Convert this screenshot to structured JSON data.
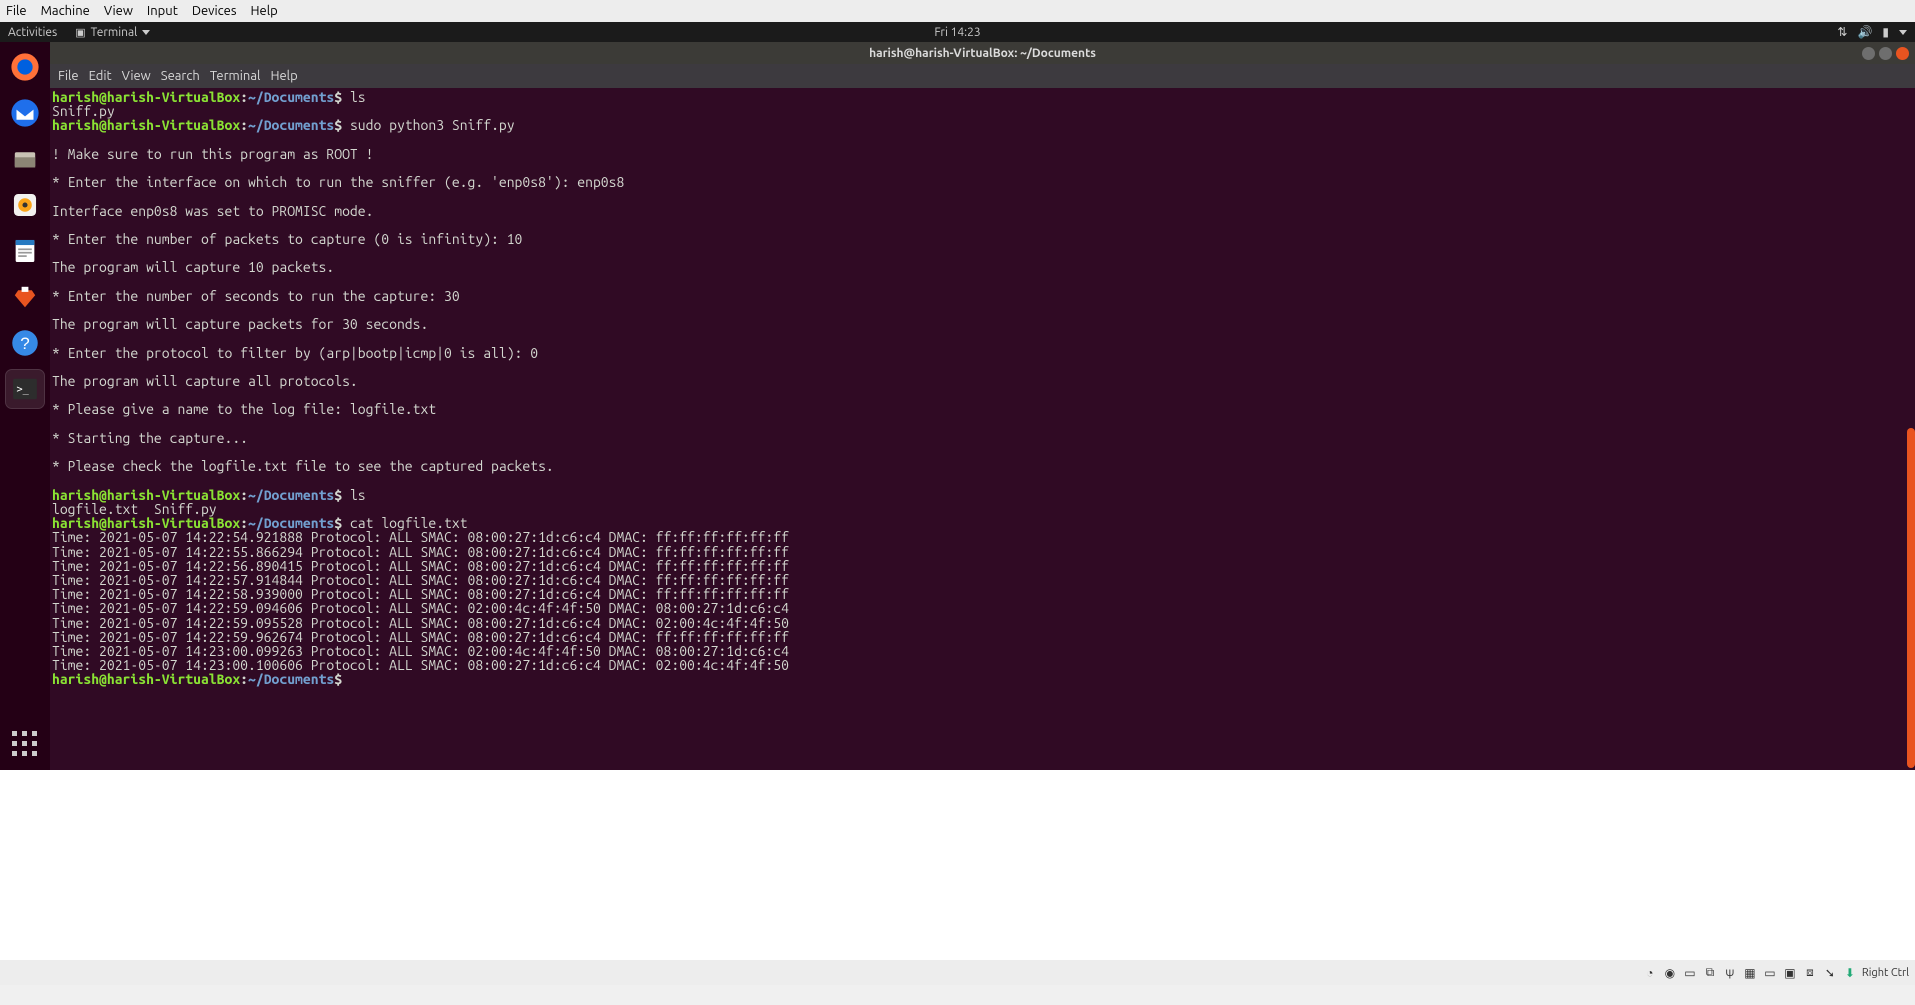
{
  "vbox_menu": [
    "File",
    "Machine",
    "View",
    "Input",
    "Devices",
    "Help"
  ],
  "gnome": {
    "activities": "Activities",
    "app": "Terminal",
    "time": "Fri 14:23"
  },
  "window": {
    "title": "harish@harish-VirtualBox: ~/Documents",
    "menus": [
      "File",
      "Edit",
      "View",
      "Search",
      "Terminal",
      "Help"
    ]
  },
  "prompt": {
    "user": "harish@harish-VirtualBox",
    "path": "~/Documents",
    "sep": ":",
    "sym": "$"
  },
  "cmd": {
    "ls1": "ls",
    "lsout1": "Sniff.py",
    "run": "sudo python3 Sniff.py",
    "ls2": "ls",
    "lsout2": "logfile.txt  Sniff.py",
    "cat": "cat logfile.txt"
  },
  "prog": {
    "l1": "! Make sure to run this program as ROOT !",
    "l2": "* Enter the interface on which to run the sniffer (e.g. 'enp0s8'): enp0s8",
    "l3": "Interface enp0s8 was set to PROMISC mode.",
    "l4": "* Enter the number of packets to capture (0 is infinity): 10",
    "l5": "The program will capture 10 packets.",
    "l6": "* Enter the number of seconds to run the capture: 30",
    "l7": "The program will capture packets for 30 seconds.",
    "l8": "* Enter the protocol to filter by (arp|bootp|icmp|0 is all): 0",
    "l9": "The program will capture all protocols.",
    "l10": "* Please give a name to the log file: logfile.txt",
    "l11": "* Starting the capture...",
    "l12": "* Please check the logfile.txt file to see the captured packets."
  },
  "log": [
    "Time: 2021-05-07 14:22:54.921888 Protocol: ALL SMAC: 08:00:27:1d:c6:c4 DMAC: ff:ff:ff:ff:ff:ff",
    "Time: 2021-05-07 14:22:55.866294 Protocol: ALL SMAC: 08:00:27:1d:c6:c4 DMAC: ff:ff:ff:ff:ff:ff",
    "Time: 2021-05-07 14:22:56.890415 Protocol: ALL SMAC: 08:00:27:1d:c6:c4 DMAC: ff:ff:ff:ff:ff:ff",
    "Time: 2021-05-07 14:22:57.914844 Protocol: ALL SMAC: 08:00:27:1d:c6:c4 DMAC: ff:ff:ff:ff:ff:ff",
    "Time: 2021-05-07 14:22:58.939000 Protocol: ALL SMAC: 08:00:27:1d:c6:c4 DMAC: ff:ff:ff:ff:ff:ff",
    "Time: 2021-05-07 14:22:59.094606 Protocol: ALL SMAC: 02:00:4c:4f:4f:50 DMAC: 08:00:27:1d:c6:c4",
    "Time: 2021-05-07 14:22:59.095528 Protocol: ALL SMAC: 08:00:27:1d:c6:c4 DMAC: 02:00:4c:4f:4f:50",
    "Time: 2021-05-07 14:22:59.962674 Protocol: ALL SMAC: 08:00:27:1d:c6:c4 DMAC: ff:ff:ff:ff:ff:ff",
    "Time: 2021-05-07 14:23:00.099263 Protocol: ALL SMAC: 02:00:4c:4f:4f:50 DMAC: 08:00:27:1d:c6:c4",
    "Time: 2021-05-07 14:23:00.100606 Protocol: ALL SMAC: 08:00:27:1d:c6:c4 DMAC: 02:00:4c:4f:4f:50"
  ],
  "status": {
    "hostkey": "Right Ctrl"
  }
}
